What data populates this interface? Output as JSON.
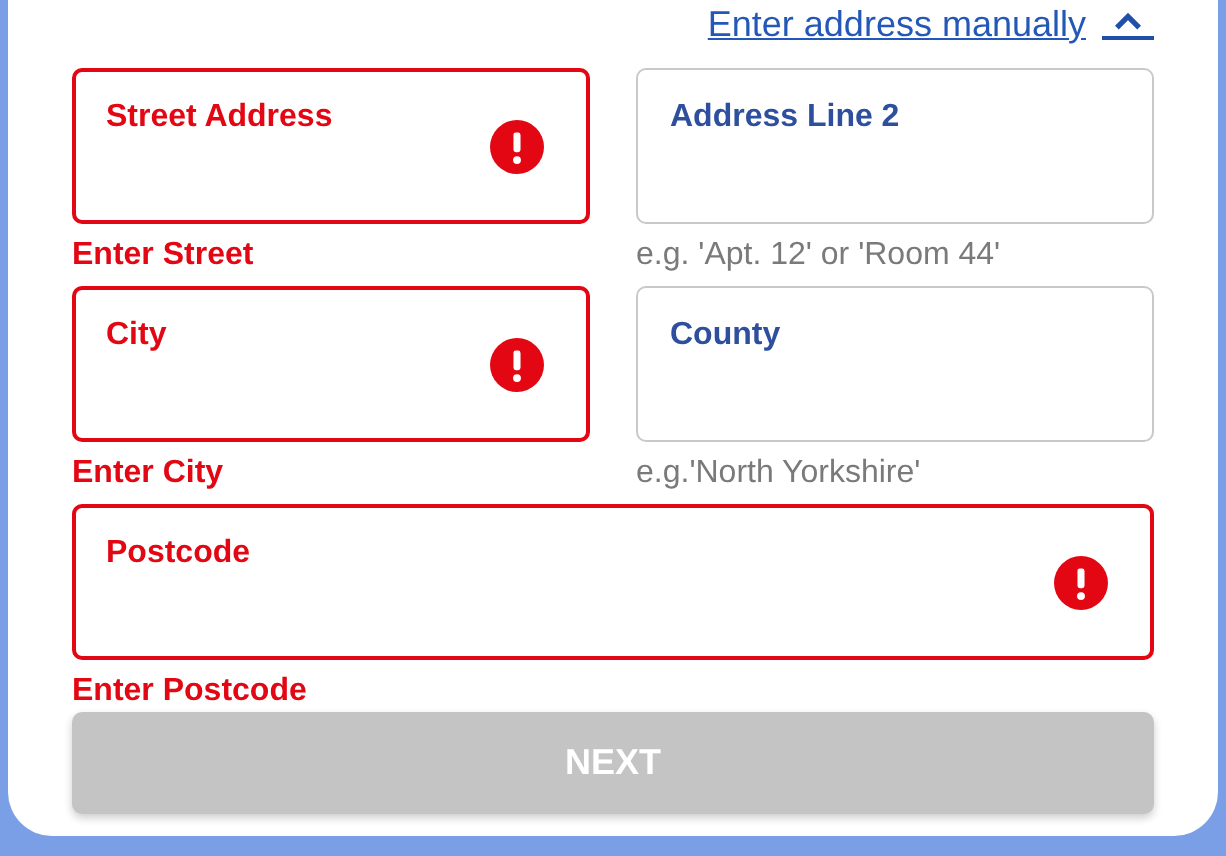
{
  "manual_link": {
    "label": "Enter address manually",
    "expanded": true
  },
  "fields": [
    {
      "label": "Street Address",
      "error": true,
      "helper": "Enter Street",
      "wide": false
    },
    {
      "label": "Address Line 2",
      "error": false,
      "helper": "e.g. 'Apt. 12' or 'Room 44'",
      "wide": false
    },
    {
      "label": "City",
      "error": true,
      "helper": "Enter City",
      "wide": false
    },
    {
      "label": "County",
      "error": false,
      "helper": "e.g.'North Yorkshire'",
      "wide": false
    },
    {
      "label": "Postcode",
      "error": true,
      "helper": "Enter Postcode",
      "wide": true
    }
  ],
  "next_button": {
    "label": "NEXT",
    "disabled": true
  }
}
